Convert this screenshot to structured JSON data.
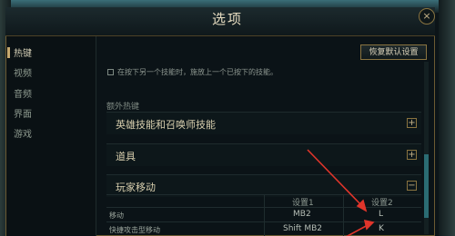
{
  "window": {
    "title": "选项",
    "close_icon": "×"
  },
  "sidebar": {
    "items": [
      {
        "label": "热键",
        "active": true
      },
      {
        "label": "视频"
      },
      {
        "label": "音频"
      },
      {
        "label": "界面"
      },
      {
        "label": "游戏"
      }
    ]
  },
  "toolbar": {
    "reset_label": "恢复默认设置"
  },
  "options": {
    "option_text": "在按下另一个技能时，施放上一个已按下的技能。",
    "checked": false
  },
  "extra_hotkeys": {
    "header": "额外热键",
    "groups": [
      {
        "label": "英雄技能和召唤师技能",
        "toggle": "+"
      },
      {
        "label": "道具",
        "toggle": "+"
      },
      {
        "label": "玩家移动",
        "toggle": "−"
      }
    ]
  },
  "table": {
    "headers": [
      "设置1",
      "设置2"
    ],
    "rows": [
      {
        "action": "移动",
        "setting1": "MB2",
        "setting2": "L"
      },
      {
        "action": "快捷攻击型移动",
        "setting1": "Shift MB2",
        "setting2": "K"
      }
    ]
  },
  "colors": {
    "accent": "#c8aa6e",
    "arrow": "#e0352b",
    "scrollbar": "#2b6c73"
  }
}
